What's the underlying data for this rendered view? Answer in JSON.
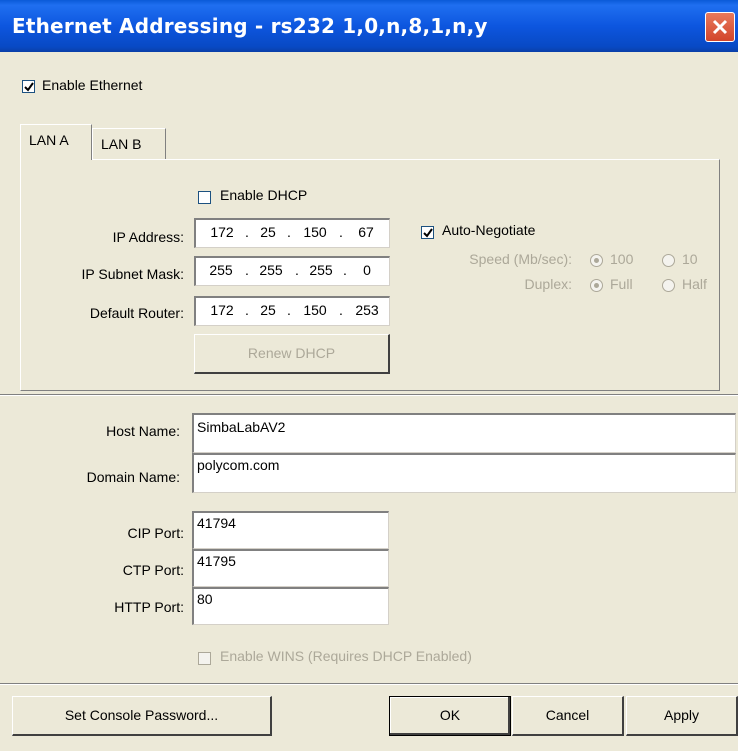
{
  "window": {
    "title": "Ethernet Addressing - rs232 1,0,n,8,1,n,y"
  },
  "enable_ethernet": {
    "label": "Enable Ethernet",
    "checked": true
  },
  "tabs": [
    {
      "label": "LAN A",
      "active": true
    },
    {
      "label": "LAN B",
      "active": false
    }
  ],
  "lan": {
    "enable_dhcp": {
      "label": "Enable DHCP",
      "checked": false
    },
    "ip_address": {
      "label": "IP Address:",
      "octets": [
        "172",
        "25",
        "150",
        "67"
      ]
    },
    "subnet_mask": {
      "label": "IP Subnet Mask:",
      "octets": [
        "255",
        "255",
        "255",
        "0"
      ]
    },
    "default_router": {
      "label": "Default Router:",
      "octets": [
        "172",
        "25",
        "150",
        "253"
      ]
    },
    "renew_dhcp": "Renew DHCP",
    "auto_negotiate": {
      "label": "Auto-Negotiate",
      "checked": true
    },
    "speed": {
      "label": "Speed (Mb/sec):",
      "options": [
        "100",
        "10"
      ],
      "selected": "100"
    },
    "duplex": {
      "label": "Duplex:",
      "options": [
        "Full",
        "Half"
      ],
      "selected": "Full"
    }
  },
  "host_name": {
    "label": "Host Name:",
    "value": "SimbaLabAV2"
  },
  "domain_name": {
    "label": "Domain Name:",
    "value": "polycom.com"
  },
  "cip_port": {
    "label": "CIP Port:",
    "value": "41794"
  },
  "ctp_port": {
    "label": "CTP Port:",
    "value": "41795"
  },
  "http_port": {
    "label": "HTTP Port:",
    "value": "80"
  },
  "enable_wins": {
    "label": "Enable WINS (Requires DHCP Enabled)",
    "checked": false
  },
  "buttons": {
    "set_console_password": "Set Console Password...",
    "ok": "OK",
    "cancel": "Cancel",
    "apply": "Apply"
  }
}
